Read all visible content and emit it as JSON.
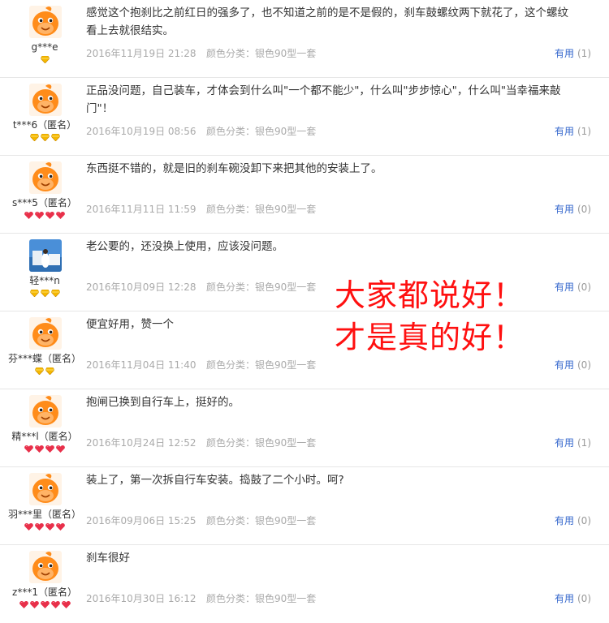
{
  "meta_label": "颜色分类：",
  "helpful_label": "有用",
  "colors": {
    "link_blue": "#3366cc",
    "overlay_red": "#ff1010",
    "gold_badge": "#f5b800",
    "red_badge": "#e8304a",
    "avatar_orange": "#ff8c1a"
  },
  "overlay": {
    "line1": "大家都说好！",
    "line2": "才是真的好！"
  },
  "reviews": [
    {
      "user": "g***e",
      "avatar_icon": "orange-mascot-icon",
      "badge_type": "gold",
      "badge_count": 1,
      "text": "感觉这个抱刹比之前红日的强多了，也不知道之前的是不是假的，刹车鼓螺纹两下就花了，这个螺纹看上去就很结实。",
      "date": "2016年11月19日 21:28",
      "option": "银色90型一套",
      "helpful_count": "(1)"
    },
    {
      "user": "t***6（匿名）",
      "avatar_icon": "orange-mascot-icon",
      "badge_type": "gold",
      "badge_count": 3,
      "text": "正品没问题，自己装车，才体会到什么叫\"一个都不能少\"，什么叫\"步步惊心\"，什么叫\"当幸福来敲门\"！",
      "date": "2016年10月19日 08:56",
      "option": "银色90型一套",
      "helpful_count": "(1)"
    },
    {
      "user": "s***5（匿名）",
      "avatar_icon": "orange-mascot-icon",
      "badge_type": "red",
      "badge_count": 4,
      "text": "东西挺不错的，就是旧的刹车碗没卸下来把其他的安装上了。",
      "date": "2016年11月11日 11:59",
      "option": "银色90型一套",
      "helpful_count": "(0)"
    },
    {
      "user": "轻***n",
      "avatar_icon": "photo-avatar-icon",
      "badge_type": "gold",
      "badge_count": 3,
      "text": "老公要的，还没换上使用，应该没问题。",
      "date": "2016年10月09日 12:28",
      "option": "银色90型一套",
      "helpful_count": "(0)"
    },
    {
      "user": "芬***蝶（匿名）",
      "avatar_icon": "orange-mascot-icon",
      "badge_type": "gold",
      "badge_count": 2,
      "text": "便宜好用，赞一个",
      "date": "2016年11月04日 11:40",
      "option": "银色90型一套",
      "helpful_count": "(0)"
    },
    {
      "user": "精***l（匿名）",
      "avatar_icon": "orange-mascot-icon",
      "badge_type": "red",
      "badge_count": 4,
      "text": "抱闸已换到自行车上，挺好的。",
      "date": "2016年10月24日 12:52",
      "option": "银色90型一套",
      "helpful_count": "(1)"
    },
    {
      "user": "羽***里（匿名）",
      "avatar_icon": "orange-mascot-icon",
      "badge_type": "red",
      "badge_count": 4,
      "text": "装上了，第一次拆自行车安装。捣鼓了二个小时。呵?",
      "date": "2016年09月06日 15:25",
      "option": "银色90型一套",
      "helpful_count": "(0)"
    },
    {
      "user": "z***1（匿名）",
      "avatar_icon": "orange-mascot-icon",
      "badge_type": "red",
      "badge_count": 5,
      "text": "刹车很好",
      "date": "2016年10月30日 16:12",
      "option": "银色90型一套",
      "helpful_count": "(0)"
    }
  ]
}
